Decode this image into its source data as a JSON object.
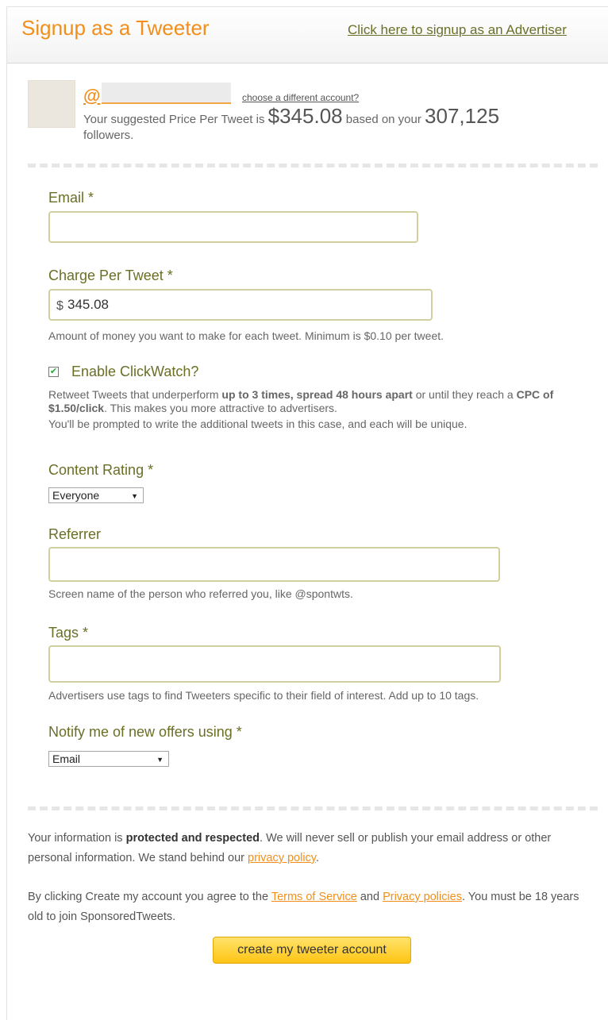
{
  "header": {
    "title": "Signup as a Tweeter",
    "advertiser_link": "Click here to signup as an Advertiser"
  },
  "account": {
    "handle_prefix": "@",
    "choose_different": "choose a different account?",
    "suggest_prefix": "Your suggested Price Per Tweet is",
    "suggested_price": "$345.08",
    "suggest_mid": "based on your",
    "followers": "307,125",
    "suggest_suffix": "followers."
  },
  "form": {
    "email": {
      "label": "Email *",
      "value": ""
    },
    "charge": {
      "label": "Charge Per Tweet *",
      "currency": "$",
      "value": "345.08",
      "help": "Amount of money you want to make for each tweet. Minimum is $0.10 per tweet."
    },
    "clickwatch": {
      "label": "Enable ClickWatch?",
      "checked": true,
      "text_1": "Retweet Tweets that underperform",
      "bold_1": "up to 3 times, spread 48 hours apart",
      "text_2": "or until they reach a",
      "bold_2": "CPC of $1.50/click",
      "text_3": ". This makes you more attractive to advertisers.",
      "text_4": "You'll be prompted to write the additional tweets in this case, and each will be unique."
    },
    "content_rating": {
      "label": "Content Rating *",
      "value": "Everyone"
    },
    "referrer": {
      "label": "Referrer",
      "value": "",
      "help": "Screen name of the person who referred you, like @spontwts."
    },
    "tags": {
      "label": "Tags *",
      "value": "",
      "help": "Advertisers use tags to find Tweeters specific to their field of interest. Add up to 10 tags."
    },
    "notify": {
      "label": "Notify me of new offers using *",
      "value": "Email"
    }
  },
  "footer": {
    "privacy_1": "Your information is",
    "privacy_bold": "protected and respected",
    "privacy_2": ". We will never sell or publish your email address or other personal information. We stand behind our",
    "privacy_link": "privacy policy",
    "privacy_3": ".",
    "terms_1": "By clicking Create my account you agree to the",
    "terms_link": "Terms of Service",
    "terms_2": "and",
    "policies_link": "Privacy policies",
    "terms_3": ". You must be 18 years old to join SponsoredTweets.",
    "submit": "create my tweeter account"
  }
}
